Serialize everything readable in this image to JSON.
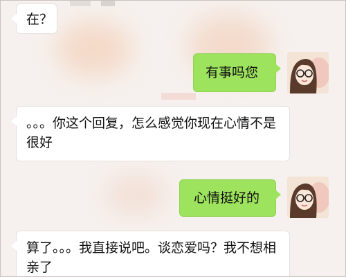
{
  "chat": {
    "messages": [
      {
        "side": "left",
        "text": "在？"
      },
      {
        "side": "right",
        "text": "有事吗您",
        "avatar_icon": "avatar-girl-glasses-icon"
      },
      {
        "side": "left",
        "text": "。。。你这个回复，怎么感觉你现在心情不是很好"
      },
      {
        "side": "right",
        "text": "心情挺好的",
        "avatar_icon": "avatar-girl-glasses-icon"
      },
      {
        "side": "left",
        "text": "算了。。。我直接说吧。谈恋爱吗？我不想相亲了"
      }
    ]
  },
  "colors": {
    "sent_bubble": "#9de35d",
    "received_bubble": "#ffffff",
    "background": "#f6f1ee"
  }
}
